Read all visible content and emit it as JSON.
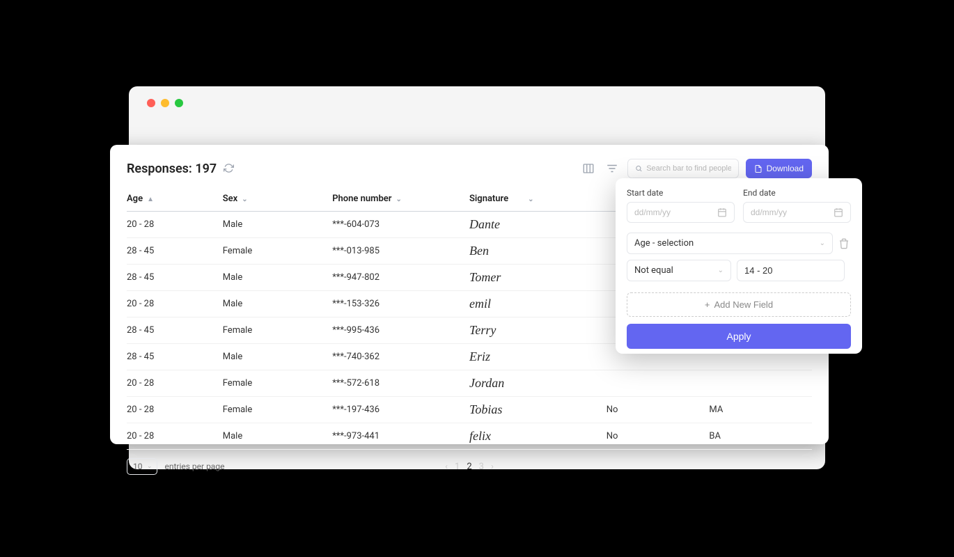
{
  "header": {
    "title_prefix": "Responses:",
    "count": "197",
    "search_placeholder": "Search bar to find people",
    "download_label": "Download"
  },
  "columns": {
    "age": "Age",
    "sex": "Sex",
    "phone": "Phone number",
    "signature": "Signature",
    "col5": "",
    "col6": ""
  },
  "rows": [
    {
      "age": "20 - 28",
      "sex": "Male",
      "phone": "***-604-073",
      "sig": "Dante",
      "c5": "",
      "c6": ""
    },
    {
      "age": "28 - 45",
      "sex": "Female",
      "phone": "***-013-985",
      "sig": "Ben",
      "c5": "",
      "c6": ""
    },
    {
      "age": "28 - 45",
      "sex": "Male",
      "phone": "***-947-802",
      "sig": "Tomer",
      "c5": "",
      "c6": ""
    },
    {
      "age": "20 - 28",
      "sex": "Male",
      "phone": "***-153-326",
      "sig": "emil",
      "c5": "",
      "c6": ""
    },
    {
      "age": "28 - 45",
      "sex": "Female",
      "phone": "***-995-436",
      "sig": "Terry",
      "c5": "",
      "c6": ""
    },
    {
      "age": "28 - 45",
      "sex": "Male",
      "phone": "***-740-362",
      "sig": "Eriz",
      "c5": "",
      "c6": ""
    },
    {
      "age": "20 - 28",
      "sex": "Female",
      "phone": "***-572-618",
      "sig": "Jordan",
      "c5": "",
      "c6": ""
    },
    {
      "age": "20 - 28",
      "sex": "Female",
      "phone": "***-197-436",
      "sig": "Tobias",
      "c5": "No",
      "c6": "MA"
    },
    {
      "age": "20 - 28",
      "sex": "Male",
      "phone": "***-973-441",
      "sig": "felix",
      "c5": "No",
      "c6": "BA"
    }
  ],
  "footer": {
    "entries_value": "10",
    "entries_label": "entries per page",
    "pages": [
      "1",
      "2",
      "3"
    ]
  },
  "filter": {
    "start_label": "Start date",
    "end_label": "End date",
    "date_placeholder": "dd/mm/yy",
    "field_select": "Age - selection",
    "operator": "Not equal",
    "value": "14 - 20",
    "add_label": "Add New Field",
    "apply_label": "Apply"
  }
}
